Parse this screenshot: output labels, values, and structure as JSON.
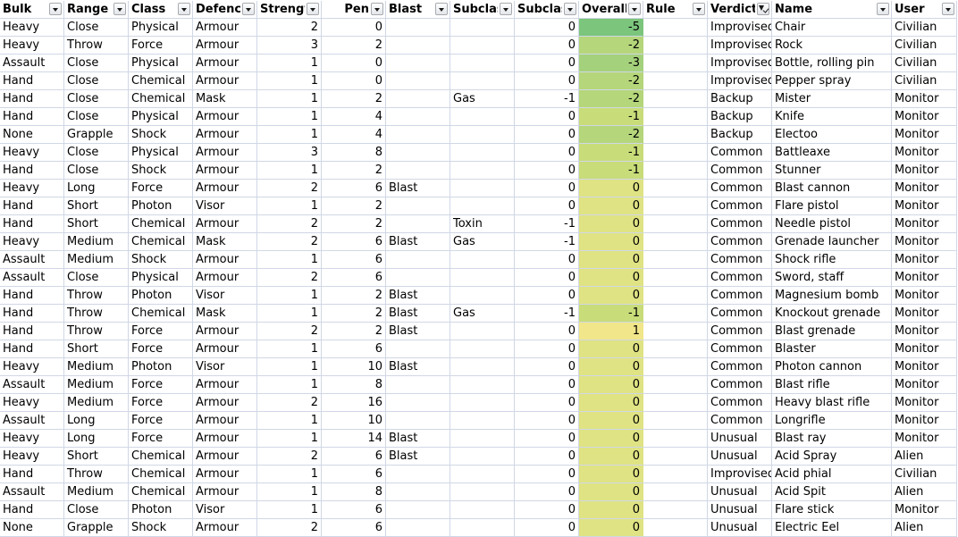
{
  "columns": [
    "Bulk",
    "Range",
    "Class",
    "Defence",
    "Strength",
    "Pen",
    "Blast",
    "Subclass",
    "Subclass",
    "Overall c",
    "Rule",
    "Verdict",
    "Name",
    "User"
  ],
  "filtered_column": "Verdict",
  "rows": [
    [
      "Heavy",
      "Close",
      "Physical",
      "Armour",
      "2",
      "0",
      "",
      "",
      "0",
      "-5",
      "",
      "Improvised",
      "Chair",
      "Civilian"
    ],
    [
      "Heavy",
      "Throw",
      "Force",
      "Armour",
      "3",
      "2",
      "",
      "",
      "0",
      "-2",
      "",
      "Improvised",
      "Rock",
      "Civilian"
    ],
    [
      "Assault",
      "Close",
      "Physical",
      "Armour",
      "1",
      "0",
      "",
      "",
      "0",
      "-3",
      "",
      "Improvised",
      "Bottle, rolling pin",
      "Civilian"
    ],
    [
      "Hand",
      "Close",
      "Chemical",
      "Armour",
      "1",
      "0",
      "",
      "",
      "0",
      "-2",
      "",
      "Improvised",
      "Pepper spray",
      "Civilian"
    ],
    [
      "Hand",
      "Close",
      "Chemical",
      "Mask",
      "1",
      "2",
      "",
      "Gas",
      "-1",
      "-2",
      "",
      "Backup",
      "Mister",
      "Monitor"
    ],
    [
      "Hand",
      "Close",
      "Physical",
      "Armour",
      "1",
      "4",
      "",
      "",
      "0",
      "-1",
      "",
      "Backup",
      "Knife",
      "Monitor"
    ],
    [
      "None",
      "Grapple",
      "Shock",
      "Armour",
      "1",
      "4",
      "",
      "",
      "0",
      "-2",
      "",
      "Backup",
      "Electoo",
      "Monitor"
    ],
    [
      "Heavy",
      "Close",
      "Physical",
      "Armour",
      "3",
      "8",
      "",
      "",
      "0",
      "-1",
      "",
      "Common",
      "Battleaxe",
      "Monitor"
    ],
    [
      "Hand",
      "Close",
      "Shock",
      "Armour",
      "1",
      "2",
      "",
      "",
      "0",
      "-1",
      "",
      "Common",
      "Stunner",
      "Monitor"
    ],
    [
      "Heavy",
      "Long",
      "Force",
      "Armour",
      "2",
      "6",
      "Blast",
      "",
      "0",
      "0",
      "",
      "Common",
      "Blast cannon",
      "Monitor"
    ],
    [
      "Hand",
      "Short",
      "Photon",
      "Visor",
      "1",
      "2",
      "",
      "",
      "0",
      "0",
      "",
      "Common",
      "Flare pistol",
      "Monitor"
    ],
    [
      "Hand",
      "Short",
      "Chemical",
      "Armour",
      "2",
      "2",
      "",
      "Toxin",
      "-1",
      "0",
      "",
      "Common",
      "Needle pistol",
      "Monitor"
    ],
    [
      "Heavy",
      "Medium",
      "Chemical",
      "Mask",
      "2",
      "6",
      "Blast",
      "Gas",
      "-1",
      "0",
      "",
      "Common",
      "Grenade launcher",
      "Monitor"
    ],
    [
      "Assault",
      "Medium",
      "Shock",
      "Armour",
      "1",
      "6",
      "",
      "",
      "0",
      "0",
      "",
      "Common",
      "Shock rifle",
      "Monitor"
    ],
    [
      "Assault",
      "Close",
      "Physical",
      "Armour",
      "2",
      "6",
      "",
      "",
      "0",
      "0",
      "",
      "Common",
      "Sword, staff",
      "Monitor"
    ],
    [
      "Hand",
      "Throw",
      "Photon",
      "Visor",
      "1",
      "2",
      "Blast",
      "",
      "0",
      "0",
      "",
      "Common",
      "Magnesium bomb",
      "Monitor"
    ],
    [
      "Hand",
      "Throw",
      "Chemical",
      "Mask",
      "1",
      "2",
      "Blast",
      "Gas",
      "-1",
      "-1",
      "",
      "Common",
      "Knockout grenade",
      "Monitor"
    ],
    [
      "Hand",
      "Throw",
      "Force",
      "Armour",
      "2",
      "2",
      "Blast",
      "",
      "0",
      "1",
      "",
      "Common",
      "Blast grenade",
      "Monitor"
    ],
    [
      "Hand",
      "Short",
      "Force",
      "Armour",
      "1",
      "6",
      "",
      "",
      "0",
      "0",
      "",
      "Common",
      "Blaster",
      "Monitor"
    ],
    [
      "Heavy",
      "Medium",
      "Photon",
      "Visor",
      "1",
      "10",
      "Blast",
      "",
      "0",
      "0",
      "",
      "Common",
      "Photon cannon",
      "Monitor"
    ],
    [
      "Assault",
      "Medium",
      "Force",
      "Armour",
      "1",
      "8",
      "",
      "",
      "0",
      "0",
      "",
      "Common",
      "Blast rifle",
      "Monitor"
    ],
    [
      "Heavy",
      "Medium",
      "Force",
      "Armour",
      "2",
      "16",
      "",
      "",
      "0",
      "0",
      "",
      "Common",
      "Heavy blast rifle",
      "Monitor"
    ],
    [
      "Assault",
      "Long",
      "Force",
      "Armour",
      "1",
      "10",
      "",
      "",
      "0",
      "0",
      "",
      "Common",
      "Longrifle",
      "Monitor"
    ],
    [
      "Heavy",
      "Long",
      "Force",
      "Armour",
      "1",
      "14",
      "Blast",
      "",
      "0",
      "0",
      "",
      "Unusual",
      "Blast ray",
      "Monitor"
    ],
    [
      "Heavy",
      "Short",
      "Chemical",
      "Armour",
      "2",
      "6",
      "Blast",
      "",
      "0",
      "0",
      "",
      "Unusual",
      "Acid Spray",
      "Alien"
    ],
    [
      "Hand",
      "Throw",
      "Chemical",
      "Armour",
      "1",
      "6",
      "",
      "",
      "0",
      "0",
      "",
      "Improvised",
      "Acid phial",
      "Civilian"
    ],
    [
      "Assault",
      "Medium",
      "Chemical",
      "Armour",
      "1",
      "8",
      "",
      "",
      "0",
      "0",
      "",
      "Unusual",
      "Acid Spit",
      "Alien"
    ],
    [
      "Hand",
      "Close",
      "Photon",
      "Visor",
      "1",
      "6",
      "",
      "",
      "0",
      "0",
      "",
      "Unusual",
      "Flare stick",
      "Monitor"
    ],
    [
      "None",
      "Grapple",
      "Shock",
      "Armour",
      "2",
      "6",
      "",
      "",
      "0",
      "0",
      "",
      "Unusual",
      "Electric Eel",
      "Alien"
    ]
  ],
  "scale_colors": {
    "-5": "#7cc57d",
    "-3": "#a4d17b",
    "-2": "#b5d67a",
    "-1": "#c8dc79",
    "0": "#dfe383",
    "1": "#f1e689"
  }
}
